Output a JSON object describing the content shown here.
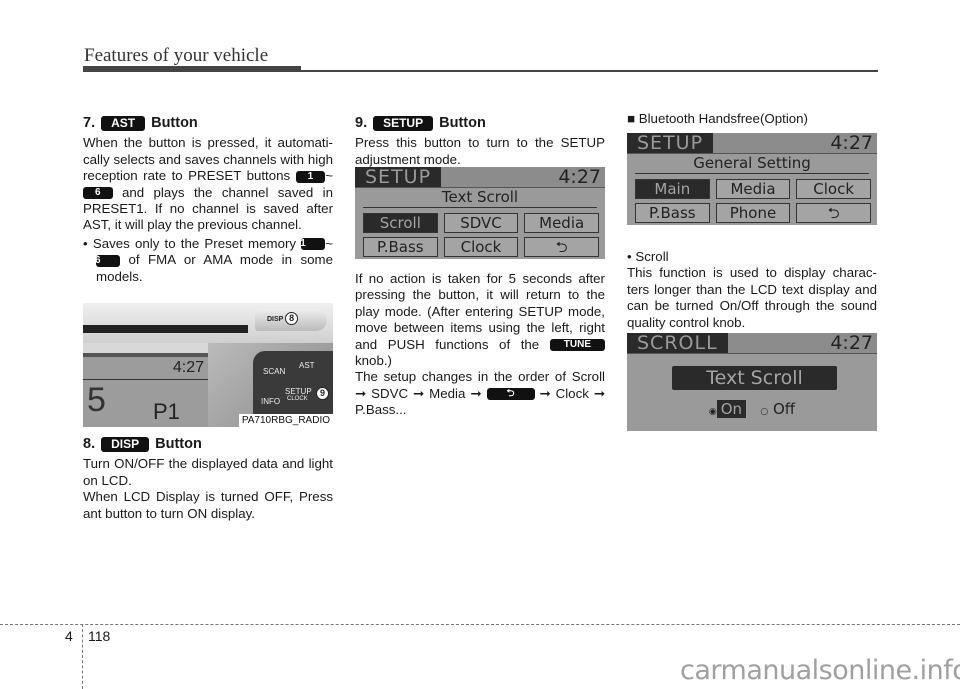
{
  "header": {
    "title": "Features of your vehicle"
  },
  "col1": {
    "s7": {
      "num": "7.",
      "badge": "AST",
      "word": "Button",
      "p1a": "When the button is pressed, it automati-cally selects and saves channels with high reception rate to PRESET buttons",
      "p1_k1": "1",
      "p1_tilde": "~",
      "p1_k2": "6",
      "p1b": "and plays the channel saved in PRESET1. If no channel is saved after AST, it will play the previous channel.",
      "bullet_a": "• Saves only to the Preset memory",
      "b_k1": "1",
      "b_tilde": "~",
      "b_k2": "6",
      "bullet_b": "of FMA or AMA mode in some models."
    },
    "photo": {
      "time": "4:27",
      "big": "5",
      "preset": "P1",
      "disp": "DISP",
      "scan": "SCAN",
      "ast": "AST",
      "info": "INFO",
      "setup": "SETUP",
      "clock": "CLOCK",
      "callout8": "8",
      "callout9": "9",
      "caption": "PA710RBG_RADIO"
    },
    "s8": {
      "num": "8.",
      "badge": "DISP",
      "word": "Button",
      "p1": "Turn ON/OFF the displayed data and light on LCD.",
      "p2": "When LCD Display is turned OFF, Press ant button to turn ON display."
    }
  },
  "col2": {
    "s9": {
      "num": "9.",
      "badge": "SETUP",
      "word": "Button",
      "p1": "Press this button to turn to the SETUP adjustment mode."
    },
    "lcd1": {
      "mode": "SETUP",
      "time": "4:27",
      "subtitle": "Text Scroll",
      "buttons": [
        {
          "label": "Scroll",
          "selected": true
        },
        {
          "label": "SDVC",
          "selected": false
        },
        {
          "label": "Media",
          "selected": false
        },
        {
          "label": "P.Bass",
          "selected": false
        },
        {
          "label": "Clock",
          "selected": false
        },
        {
          "label": "⮌",
          "selected": false
        }
      ]
    },
    "p2a": "If no action is taken for 5 seconds after pressing the button, it will return to the play mode. (After entering SETUP mode, move between items using the left, right and PUSH functions of the",
    "tune": "TUNE",
    "p2b": "knob.)",
    "p3a": "The setup changes in the order of Scroll ➞ SDVC ➞ Media ➞",
    "back_glyph": "⮌",
    "p3b": "➞ Clock ➞ P.Bass..."
  },
  "col3": {
    "heading": "■ Bluetooth Handsfree(Option)",
    "lcd2": {
      "mode": "SETUP",
      "time": "4:27",
      "subtitle": "General Setting",
      "buttons": [
        {
          "label": "Main",
          "selected": true
        },
        {
          "label": "Media",
          "selected": false
        },
        {
          "label": "Clock",
          "selected": false
        },
        {
          "label": "P.Bass",
          "selected": false
        },
        {
          "label": "Phone",
          "selected": false
        },
        {
          "label": "⮌",
          "selected": false
        }
      ]
    },
    "bullet": "• Scroll",
    "p1": "This function is used to display charac-ters longer than the LCD text display and can be turned On/Off through the sound quality control knob.",
    "lcd3": {
      "mode": "SCROLL",
      "time": "4:27",
      "title": "Text Scroll",
      "opt_on": "On",
      "opt_off": "Off",
      "on_radio": "◉",
      "off_radio": "○"
    }
  },
  "footer": {
    "chapter": "4",
    "page": "118",
    "watermark": "carmanualsonline.info"
  }
}
